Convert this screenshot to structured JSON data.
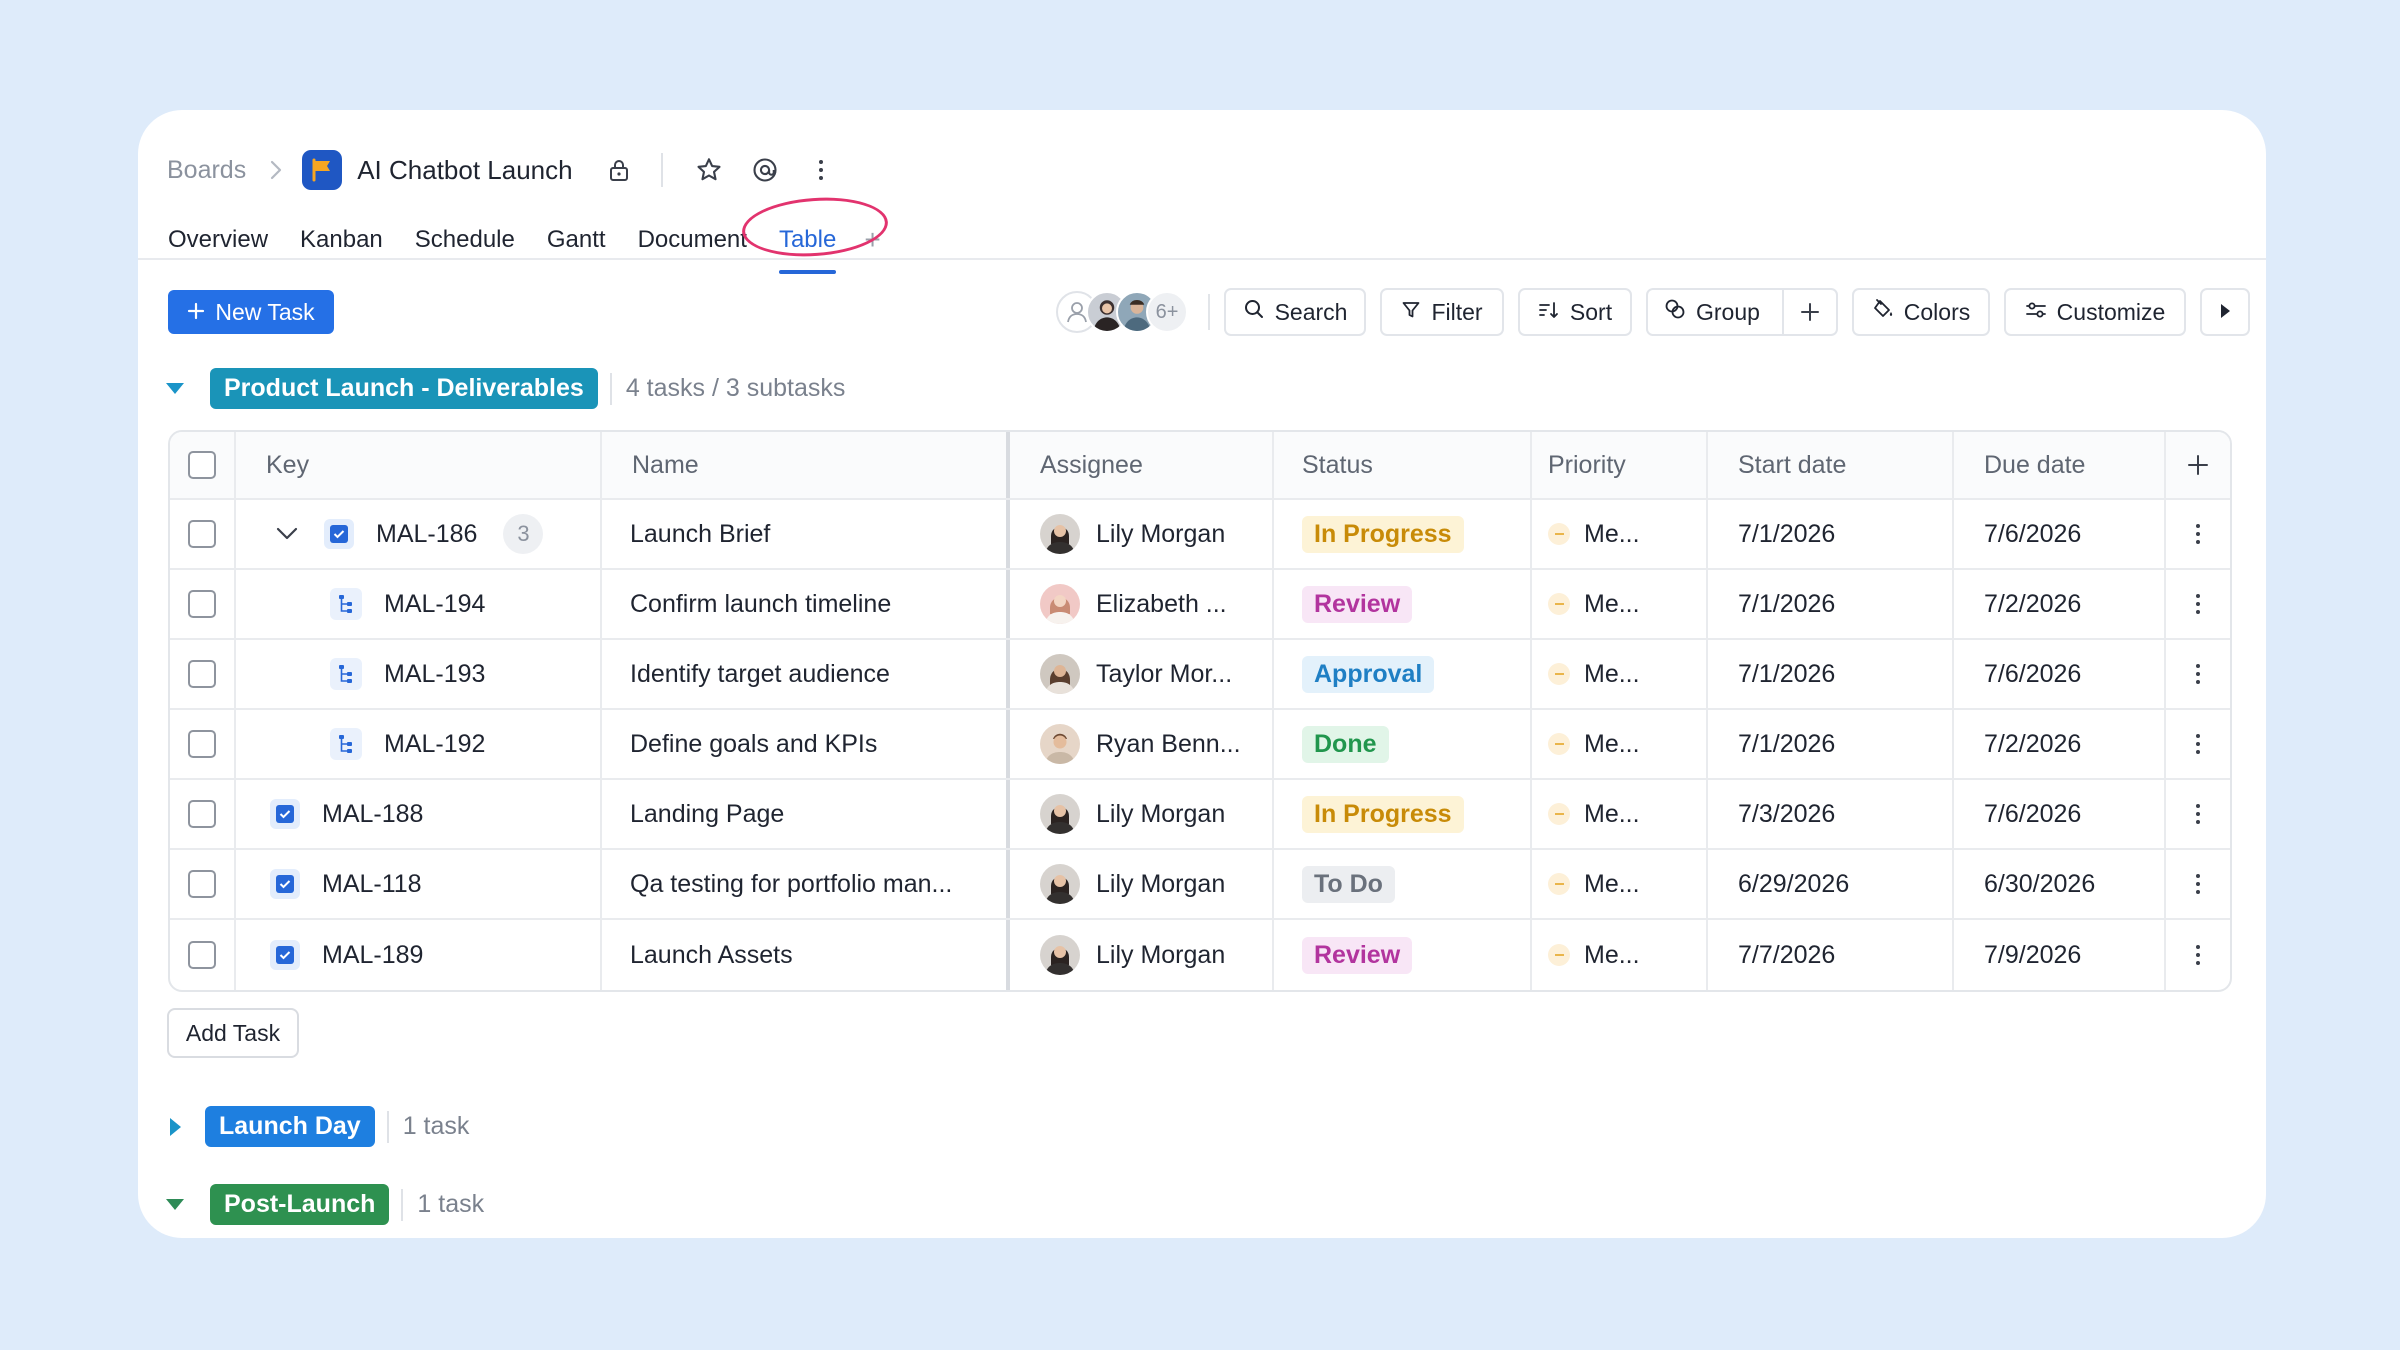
{
  "header": {
    "breadcrumb_root": "Boards",
    "project_title": "AI Chatbot Launch"
  },
  "tabs": [
    {
      "label": "Overview"
    },
    {
      "label": "Kanban"
    },
    {
      "label": "Schedule"
    },
    {
      "label": "Gantt"
    },
    {
      "label": "Document"
    },
    {
      "label": "Table",
      "active": true
    }
  ],
  "toolbar": {
    "new_task": "New Task",
    "members_more": "6+",
    "search": "Search",
    "filter": "Filter",
    "sort": "Sort",
    "group": "Group",
    "colors": "Colors",
    "customize": "Customize"
  },
  "groups": [
    {
      "label": "Product Launch - Deliverables",
      "count": "4 tasks / 3 subtasks",
      "color": "#1a94b8",
      "expanded": true
    },
    {
      "label": "Launch Day",
      "count": "1 task",
      "color": "#1e7fe0",
      "expanded": false
    },
    {
      "label": "Post-Launch",
      "count": "1 task",
      "color": "#2e9150",
      "expanded": true
    }
  ],
  "table": {
    "columns": [
      "Key",
      "Name",
      "Assignee",
      "Status",
      "Priority",
      "Start date",
      "Due date"
    ],
    "rows": [
      {
        "key": "MAL-186",
        "subtask_count": "3",
        "name": "Launch Brief",
        "assignee": "Lily Morgan",
        "status": "In Progress",
        "priority": "Me...",
        "start": "7/1/2026",
        "due": "7/6/2026"
      },
      {
        "key": "MAL-194",
        "name": "Confirm launch timeline",
        "assignee": "Elizabeth ...",
        "status": "Review",
        "priority": "Me...",
        "start": "7/1/2026",
        "due": "7/2/2026"
      },
      {
        "key": "MAL-193",
        "name": "Identify target audience",
        "assignee": "Taylor Mor...",
        "status": "Approval",
        "priority": "Me...",
        "start": "7/1/2026",
        "due": "7/6/2026"
      },
      {
        "key": "MAL-192",
        "name": "Define goals and KPIs",
        "assignee": "Ryan Benn...",
        "status": "Done",
        "priority": "Me...",
        "start": "7/1/2026",
        "due": "7/2/2026"
      },
      {
        "key": "MAL-188",
        "name": "Landing Page",
        "assignee": "Lily Morgan",
        "status": "In Progress",
        "priority": "Me...",
        "start": "7/3/2026",
        "due": "7/6/2026"
      },
      {
        "key": "MAL-118",
        "name": "Qa testing for portfolio man...",
        "assignee": "Lily Morgan",
        "status": "To Do",
        "priority": "Me...",
        "start": "6/29/2026",
        "due": "6/30/2026"
      },
      {
        "key": "MAL-189",
        "name": "Launch Assets",
        "assignee": "Lily Morgan",
        "status": "Review",
        "priority": "Me...",
        "start": "7/7/2026",
        "due": "7/9/2026"
      }
    ]
  },
  "add_task": "Add Task"
}
